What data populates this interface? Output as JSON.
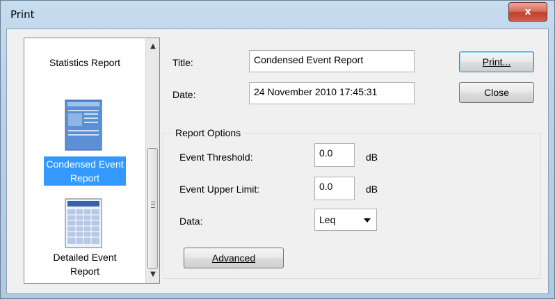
{
  "window": {
    "title": "Print",
    "close_glyph": "x"
  },
  "report_list": {
    "items": [
      {
        "label": "Statistics Report",
        "selected": false
      },
      {
        "label_line1": "Condensed Event",
        "label_line2": "Report",
        "icon": "condensed-report-icon",
        "selected": true
      },
      {
        "label_line1": "Detailed Event",
        "label_line2": "Report",
        "icon": "detailed-report-icon",
        "selected": false
      }
    ]
  },
  "form": {
    "title_label": "Title:",
    "title_value": "Condensed Event Report",
    "date_label": "Date:",
    "date_value": "24 November 2010 17:45:31"
  },
  "buttons": {
    "print_label": "Print...",
    "close_label": "Close",
    "advanced_label": "Advanced"
  },
  "report_options": {
    "group_title": "Report Options",
    "threshold_label": "Event Threshold:",
    "threshold_value": "0.0",
    "threshold_unit": "dB",
    "upper_label": "Event Upper Limit:",
    "upper_value": "0.0",
    "upper_unit": "dB",
    "data_label": "Data:",
    "data_value": "Leq"
  },
  "colors": {
    "selection": "#3399ff",
    "close_red": "#c0402b"
  }
}
